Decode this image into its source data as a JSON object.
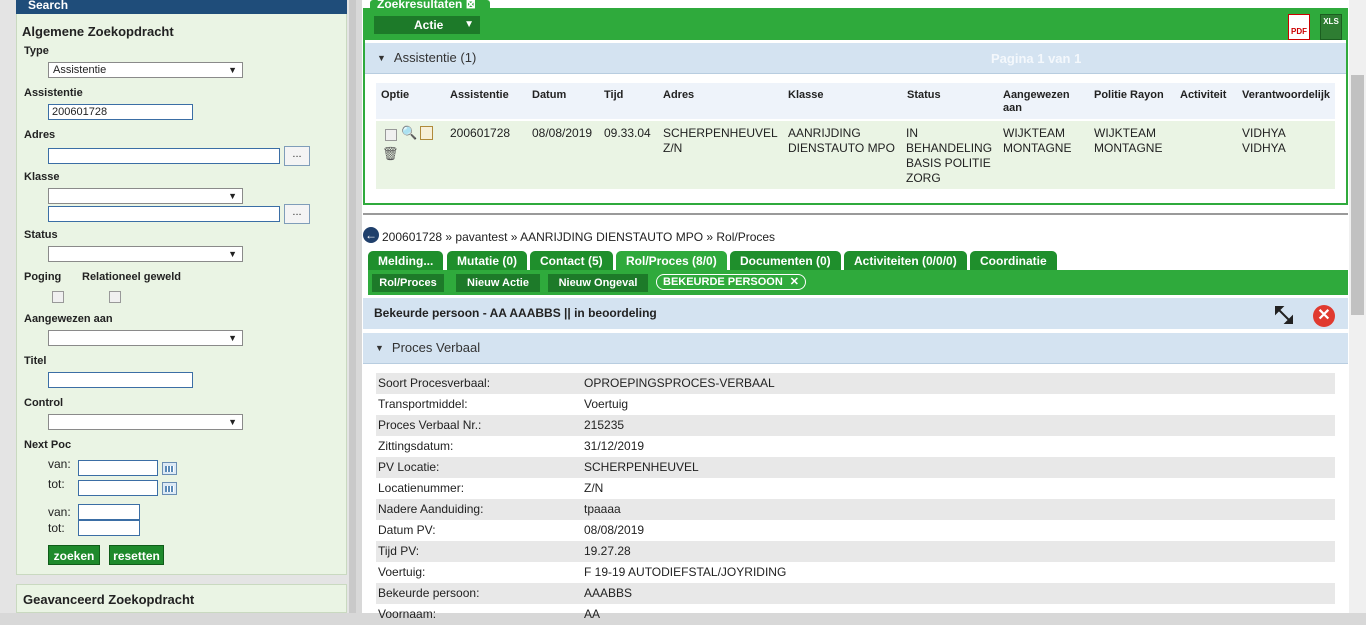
{
  "left": {
    "header": "Search",
    "section_title": "Algemene Zoekopdracht",
    "type_label": "Type",
    "type_value": "Assistentie",
    "assistentie_label": "Assistentie",
    "assistentie_value": "200601728",
    "adres_label": "Adres",
    "klasse_label": "Klasse",
    "status_label": "Status",
    "poging_label": "Poging",
    "relationeel_label": "Relationeel geweld",
    "aangewezen_label": "Aangewezen aan",
    "titel_label": "Titel",
    "control_label": "Control",
    "nextpoc_label": "Next Poc",
    "van_label": "van:",
    "tot_label": "tot:",
    "dots": "...",
    "zoeken": "zoeken",
    "resetten": "resetten",
    "advanced_title": "Geavanceerd Zoekopdracht"
  },
  "results": {
    "tab_label": "Zoekresultaten",
    "actie_label": "Actie",
    "pdf_label": "PDF",
    "xls_label": "XLS",
    "group_title": "Assistentie (1)",
    "pagination": "Pagina 1 van 1",
    "columns": [
      "Optie",
      "Assistentie",
      "Datum",
      "Tijd",
      "Adres",
      "Klasse",
      "Status",
      "Aangewezen aan",
      "Politie Rayon",
      "Activiteit",
      "Verantwoordelijk"
    ],
    "row": {
      "assistentie": "200601728",
      "datum": "08/08/2019",
      "tijd": "09.33.04",
      "adres": "SCHERPENHEUVEL Z/N",
      "klasse": "AANRIJDING DIENSTAUTO MPO",
      "status": "IN BEHANDELING BASIS POLITIE ZORG",
      "aangewezen": "WIJKTEAM MONTAGNE",
      "rayon": "WIJKTEAM MONTAGNE",
      "activiteit": "",
      "verantwoordelijk": "VIDHYA VIDHYA"
    }
  },
  "detail": {
    "breadcrumb": "200601728 » pavantest » AANRIJDING DIENSTAUTO MPO » Rol/Proces",
    "tabs": [
      "Melding...",
      "Mutatie (0)",
      "Contact (5)",
      "Rol/Proces (8/0)",
      "Documenten (0)",
      "Activiteiten (0/0/0)",
      "Coordinatie"
    ],
    "subbuttons": [
      "Rol/Proces",
      "Nieuw Actie",
      "Nieuw Ongeval"
    ],
    "pill_label": "BEKEURDE PERSOON",
    "header": "Bekeurde persoon - AA AAABBS  ||  in beoordeling",
    "section_title": "Proces Verbaal",
    "fields": [
      {
        "k": "Soort Procesverbaal:",
        "v": "OPROEPINGSPROCES-VERBAAL"
      },
      {
        "k": "Transportmiddel:",
        "v": "Voertuig"
      },
      {
        "k": "Proces Verbaal Nr.:",
        "v": "215235"
      },
      {
        "k": "Zittingsdatum:",
        "v": "31/12/2019"
      },
      {
        "k": "PV Locatie:",
        "v": "SCHERPENHEUVEL"
      },
      {
        "k": "Locatienummer:",
        "v": "Z/N"
      },
      {
        "k": "Nadere Aanduiding:",
        "v": "tpaaaa"
      },
      {
        "k": "Datum PV:",
        "v": "08/08/2019"
      },
      {
        "k": "Tijd PV:",
        "v": "19.27.28"
      },
      {
        "k": "Voertuig:",
        "v": "F 19-19 AUTODIEFSTAL/JOYRIDING"
      },
      {
        "k": "Bekeurde persoon:",
        "v": "AAABBS"
      },
      {
        "k": "Voornaam:",
        "v": "AA"
      }
    ]
  },
  "colors": {
    "green": "#2faa3c",
    "dark_green": "#1d7a29",
    "blue_head": "#d4e3f1",
    "navy": "#1f4d7a",
    "close_red": "#e03a2f"
  }
}
